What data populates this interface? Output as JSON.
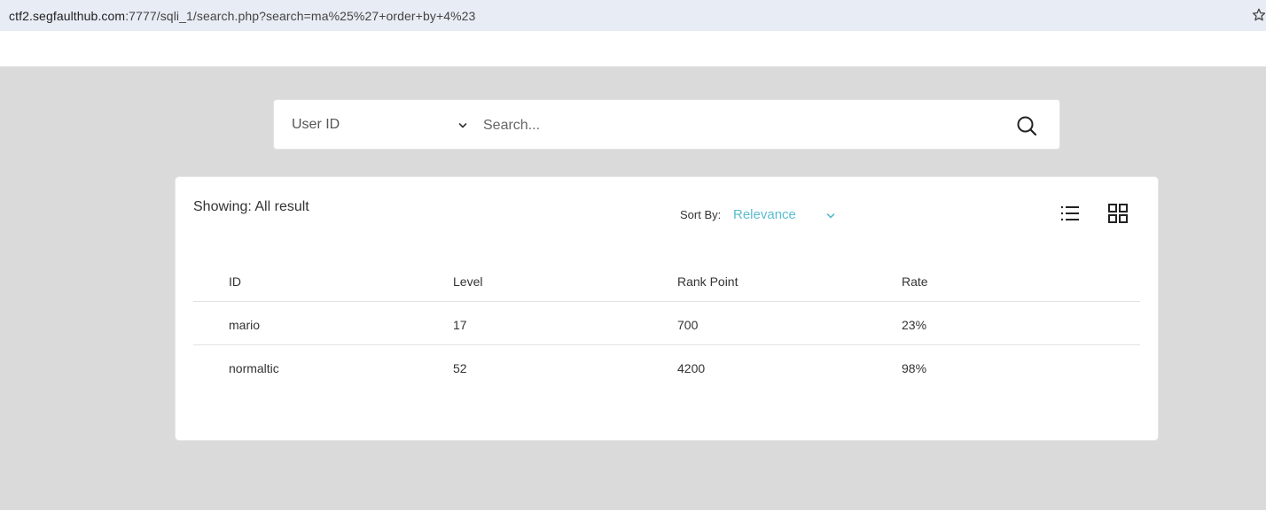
{
  "browser": {
    "url_host": "ctf2.segfaulthub.com",
    "url_rest": ":7777/sqli_1/search.php?search=ma%25%27+order+by+4%23",
    "bookmark_icon": "star-icon"
  },
  "search": {
    "field_selected": "User ID",
    "placeholder": "Search...",
    "value": "",
    "button_icon": "search-icon"
  },
  "results": {
    "showing_label": "Showing: All result",
    "sort_label": "Sort By:",
    "sort_value": "Relevance",
    "accent_color": "#5bbcd0",
    "view_icons": [
      "list-view-icon",
      "grid-view-icon"
    ],
    "columns": [
      "ID",
      "Level",
      "Rank Point",
      "Rate"
    ],
    "rows": [
      [
        "mario",
        "17",
        "700",
        "23%"
      ],
      [
        "normaltic",
        "52",
        "4200",
        "98%"
      ]
    ]
  }
}
